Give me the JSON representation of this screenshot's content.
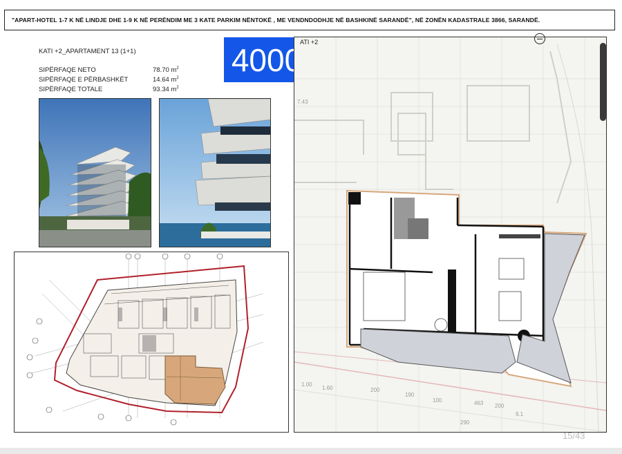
{
  "header": {
    "title": "\"APART-HOTEL 1-7 K NË LINDJE DHE 1-9 K NË PERËNDIM ME 3 KATE PARKIM NËNTOKË , ME VENDNDODHJE NË BASHKINË SARANDË\", NË ZONËN KADASTRALE 3866, SARANDË."
  },
  "apartment": {
    "heading": "KATI  +2_APARTAMENT 13   (1+1)",
    "areas": [
      {
        "label": "SIPËRFAQE NETO",
        "value": "78.70 m",
        "unit_sup": "2"
      },
      {
        "label": "SIPËRFAQE E PËRBASHKËT",
        "value": "14.64 m",
        "unit_sup": "2"
      },
      {
        "label": "SIPËRFAQE TOTALE",
        "value": "93.34 m",
        "unit_sup": "2"
      }
    ]
  },
  "badge": {
    "text": "4000",
    "color": "#1457e8"
  },
  "floor_plan": {
    "label": "ATI  +2",
    "dims": [
      "7.43",
      "1.00",
      "1.60",
      "200",
      "190",
      "100",
      "463",
      "200",
      "290",
      "9.1"
    ]
  },
  "site_plan": {
    "grid_labels": [
      "B",
      "A",
      "C",
      "D",
      "E",
      "F",
      "G",
      "1",
      "2",
      "3",
      "4",
      "5",
      "6",
      "7",
      "8",
      "A",
      "B",
      "C"
    ]
  },
  "pager": {
    "text": "15/43"
  },
  "icons": {
    "north": "north-arrow-icon"
  },
  "colors": {
    "highlight": "#d7a77b",
    "boundary": "#b0202a",
    "badge": "#1457e8"
  }
}
